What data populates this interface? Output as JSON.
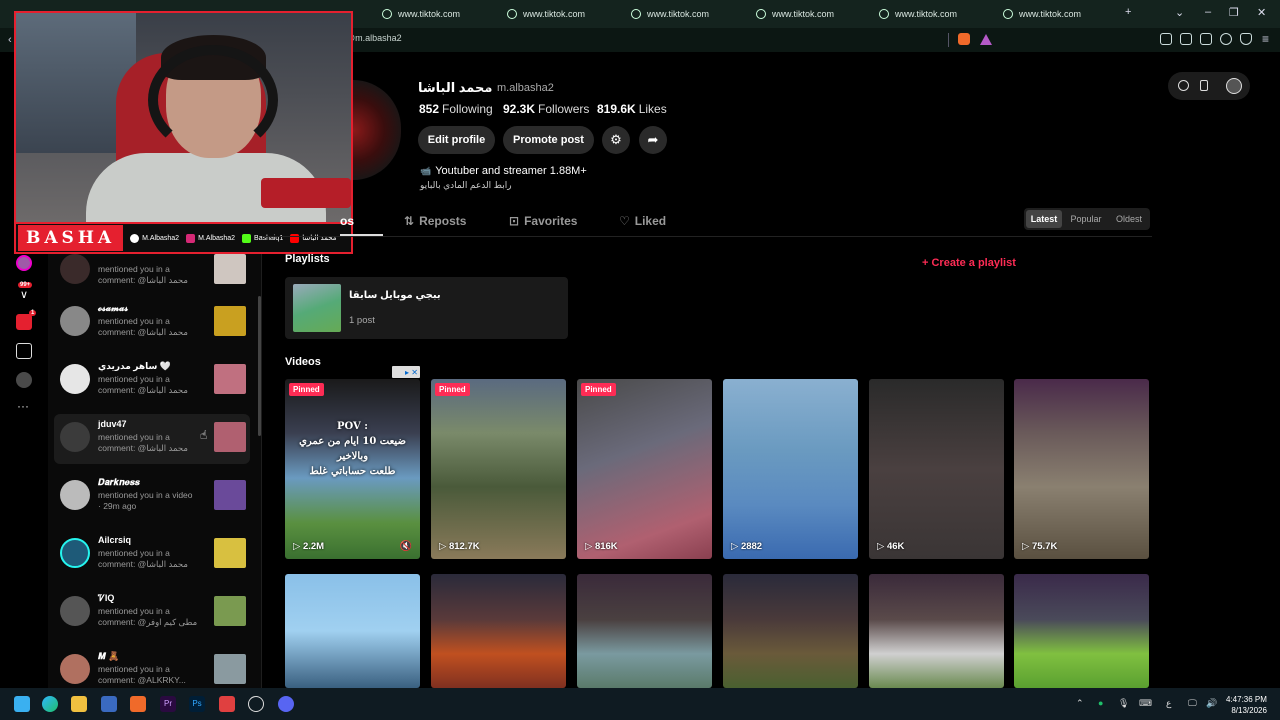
{
  "browser": {
    "tabs": [
      {
        "label": "www.tiktok.com"
      },
      {
        "label": "www.tiktok.com"
      },
      {
        "label": "www.tiktok.com"
      },
      {
        "label": "www.tiktok.com"
      },
      {
        "label": "www.tiktok.com"
      },
      {
        "label": "www.tiktok.com"
      }
    ],
    "new_tab": "+",
    "url": "@m.albasha2"
  },
  "stream_overlay": {
    "logo": "BASHA",
    "socials": [
      {
        "icon": "tiktok-icon",
        "label": "M.Albasha2",
        "color": "#ffffff"
      },
      {
        "icon": "instagram-icon",
        "label": "M.Albasha2",
        "color": "#d62976"
      },
      {
        "icon": "kick-icon",
        "label": "Bashaiq1",
        "color": "#53fc18"
      },
      {
        "icon": "youtube-icon",
        "label": "محمد الباشا",
        "color": "#ff0000"
      }
    ]
  },
  "rail": {
    "messages_badge": "99+",
    "inbox_badge": "1"
  },
  "notifications": [
    {
      "name": "",
      "line1": "mentioned you in a",
      "line2": "comment: @محمد الباشا",
      "avatar_color": "#3a2a2a",
      "thumb_color": "#cfc6c0"
    },
    {
      "name": "𝓸𝓼𝓪𝓶𝓪𝓼",
      "line1": "mentioned you in a",
      "line2": "comment: @محمد الباشا",
      "avatar_color": "#888888",
      "thumb_color": "#c9a020"
    },
    {
      "name": "ساهر مدريدي 🤍",
      "line1": "mentioned you in a",
      "line2": "comment: @محمد الباشا",
      "avatar_color": "#e6e6e6",
      "thumb_color": "#c07080"
    },
    {
      "name": "jduv47",
      "line1": "mentioned you in a",
      "line2": "comment: @محمد الباشا",
      "avatar_color": "#3b3b3b",
      "thumb_color": "#b06070"
    },
    {
      "name": "𝑫𝒂𝒓𝒌𝒏𝒆𝒔𝒔",
      "line1": "mentioned you in a video",
      "line2": "· 29m ago",
      "avatar_color": "#bbbbbb",
      "thumb_color": "#6a4a9a"
    },
    {
      "name": "Ailcrsiq",
      "line1": "mentioned you in a",
      "line2": "comment: @محمد الباشا",
      "avatar_color": "#1e5a78",
      "thumb_color": "#d8c040"
    },
    {
      "name": "ᏤIQ",
      "line1": "mentioned you in a",
      "line2": "comment: @مطى كيم اوفر",
      "avatar_color": "#555555",
      "thumb_color": "#7a9a50"
    },
    {
      "name": "𝑴 🧸",
      "line1": "mentioned you in a",
      "line2": "comment: @ALKRKY...",
      "avatar_color": "#b07060",
      "thumb_color": "#8a9aa0"
    }
  ],
  "profile": {
    "name": "محمد الباشا",
    "handle": "m.albasha2",
    "following_count": "852",
    "following_label": "Following",
    "followers_count": "92.3K",
    "followers_label": "Followers",
    "likes_count": "819.6K",
    "likes_label": "Likes",
    "edit_label": "Edit profile",
    "promote_label": "Promote post",
    "bio_line1": "Youtuber and streamer 1.88M+",
    "bio_line2": "رابط الدعم المادي بالبايو"
  },
  "tabs": {
    "videos": "Videos",
    "videos_visible": "os",
    "reposts": "Reposts",
    "favorites": "Favorites",
    "liked": "Liked"
  },
  "sort": {
    "latest": "Latest",
    "popular": "Popular",
    "oldest": "Oldest"
  },
  "playlists": {
    "title": "Playlists",
    "create_label": "Create a playlist",
    "items": [
      {
        "name": "ببجي موبايل سابقا",
        "count": "1 post"
      }
    ]
  },
  "videos": {
    "title": "Videos",
    "items": [
      {
        "pinned": "Pinned",
        "views": "2.2M",
        "caption": "POV :\nضيعت 10 ايام من عمري وبالاخير\nطلعت حساباتي غلط",
        "bg": "linear-gradient(180deg,#1a1a1a 0%,#3a3f50 30%,#6a9ac0 55%,#5a9040 80%,#3a7030 100%)"
      },
      {
        "pinned": "Pinned",
        "views": "812.7K",
        "caption": "",
        "bg": "linear-gradient(180deg,#5a6a80 0%,#7a8a6a 30%,#4a5a3a 60%,#8a7a5a 100%)"
      },
      {
        "pinned": "Pinned",
        "views": "816K",
        "caption": "",
        "bg": "linear-gradient(160deg,#4a4a4a 0%,#6a6a7a 40%,#b06070 80%,#8a4050 100%)"
      },
      {
        "pinned": "",
        "views": "2882",
        "caption": "",
        "bg": "linear-gradient(180deg,#8ab0d0 0%,#6a9ac0 40%,#5a8ac0 70%,#3a6ab0 100%)"
      },
      {
        "pinned": "",
        "views": "46K",
        "caption": "",
        "bg": "linear-gradient(180deg,#2a2a2a 0%,#4a4040 50%,#3a3535 100%)"
      },
      {
        "pinned": "",
        "views": "75.7K",
        "caption": "",
        "bg": "linear-gradient(180deg,#4a2a4a 0%,#6a5a5a 30%,#8a8070 60%,#5a5040 100%)"
      },
      {
        "pinned": "",
        "views": "",
        "caption": "",
        "bg": "linear-gradient(180deg,#8ac0e8 0%,#a0d0f0 50%,#3a6080 100%)"
      },
      {
        "pinned": "",
        "views": "",
        "caption": "",
        "bg": "linear-gradient(180deg,#2a2a3a 0%,#5a3a3a 40%,#c05020 70%,#803020 100%)"
      },
      {
        "pinned": "",
        "views": "",
        "caption": "",
        "bg": "linear-gradient(180deg,#3a2a3a 0%,#4a4040 40%,#7a9aa0 70%,#5a7a6a 100%)"
      },
      {
        "pinned": "",
        "views": "",
        "caption": "",
        "bg": "linear-gradient(180deg,#2a2a3a 0%,#4a3a3a 40%,#6a5a3a 70%,#4a6030 100%)"
      },
      {
        "pinned": "",
        "views": "",
        "caption": "",
        "bg": "linear-gradient(180deg,#3a2a3a 0%,#5a4a4a 40%,#d0d0d0 70%,#6a8a50 100%)"
      },
      {
        "pinned": "",
        "views": "",
        "caption": "",
        "bg": "linear-gradient(180deg,#3a2a4a 0%,#4a4a5a 40%,#80c040 70%,#5aa030 100%)"
      }
    ]
  },
  "taskbar": {
    "lang": "ع",
    "time": "4:47:36 PM",
    "date": "8/13/2026"
  }
}
